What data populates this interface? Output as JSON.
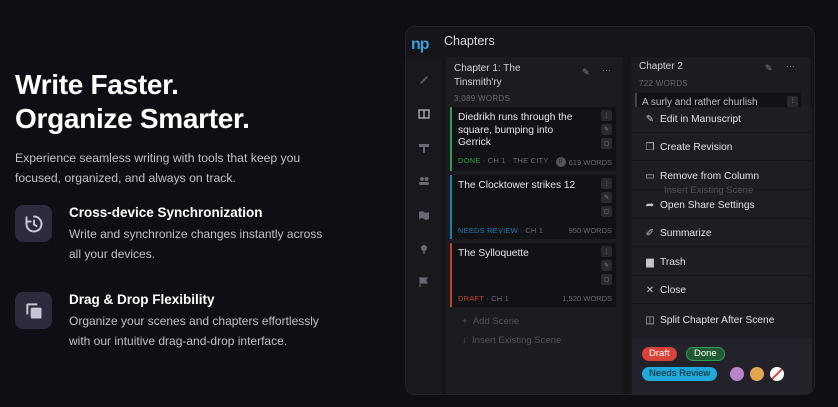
{
  "hero": {
    "line1": "Write Faster.",
    "line2": "Organize Smarter.",
    "subtitle_line1": "Experience seamless writing with tools that keep you",
    "subtitle_line2": "focused, organized, and always on track."
  },
  "features": [
    {
      "icon": "history-icon",
      "title": "Cross-device Synchronization",
      "desc_line1": "Write and synchronize changes instantly across",
      "desc_line2": "all your devices."
    },
    {
      "icon": "copy-icon",
      "title": "Drag & Drop Flexibility",
      "desc_line1": "Organize your scenes and chapters effortlessly",
      "desc_line2": "with our intuitive drag-and-drop interface."
    }
  ],
  "app": {
    "logo": "np",
    "title": "Chapters",
    "rail_icons": [
      "quill-icon",
      "book-icon",
      "signpost-icon",
      "people-icon",
      "map-icon",
      "pin-icon",
      "flag-icon"
    ],
    "chapter1": {
      "title_line1": "Chapter 1: The",
      "title_line2": "Tinsmith'ry",
      "words": "3,089 WORDS",
      "cards": [
        {
          "title_line1": "Diedrikh runs through the",
          "title_line2": "square, bumping into",
          "title_line3": "Gerrick",
          "status": "DONE",
          "meta": "· CH 1 · THE CITY ·",
          "badge": "0",
          "words": "619 WORDS",
          "color": "#2e9e55"
        },
        {
          "title_line1": "The Clocktower strikes 12",
          "title_line2": "",
          "title_line3": "",
          "status": "NEEDS REVIEW",
          "meta": "· CH 1",
          "badge": "",
          "words": "950 WORDS",
          "color": "#1f7fb0"
        },
        {
          "title_line1": "The Sylloquette",
          "title_line2": "",
          "title_line3": "",
          "status": "DRAFT",
          "meta": "· CH 1",
          "badge": "",
          "words": "1,520 WORDS",
          "color": "#c2442f"
        }
      ],
      "add_scene": "Add Scene",
      "insert_scene": "Insert Existing Scene"
    },
    "chapter2": {
      "title": "Chapter 2",
      "words": "722 WORDS",
      "card_peek": "A surly and rather churlish",
      "insert_peek": "Insert Existing Scene"
    },
    "menu": [
      {
        "icon": "quill-icon",
        "label": "Edit in Manuscript"
      },
      {
        "icon": "copy-icon",
        "label": "Create Revision"
      },
      {
        "icon": "archive-icon",
        "label": "Remove from Column"
      },
      {
        "icon": "share-icon",
        "label": "Open Share Settings"
      },
      {
        "icon": "wand-icon",
        "label": "Summarize"
      },
      {
        "icon": "trash-icon",
        "label": "Trash"
      },
      {
        "icon": "close-icon",
        "label": "Close"
      },
      {
        "icon": "split-icon",
        "label": "Split Chapter After Scene"
      }
    ],
    "tags": [
      {
        "label": "Draft",
        "color": "#d8423a"
      },
      {
        "label": "Done",
        "color": "#2e9e55"
      },
      {
        "label": "Needs Review",
        "color": "#1fa8d8"
      }
    ],
    "color_dots": [
      "#b884c8",
      "#e3a650",
      "#ffffff"
    ]
  }
}
